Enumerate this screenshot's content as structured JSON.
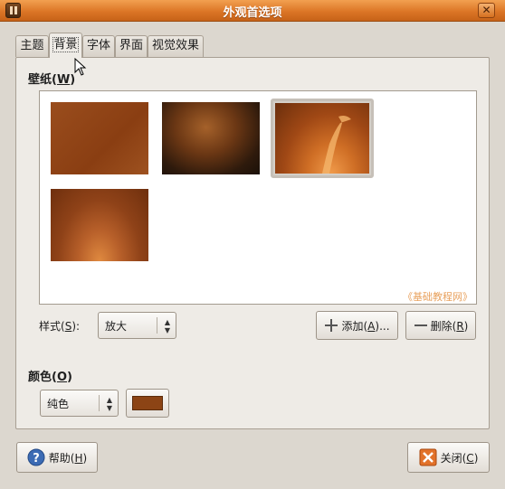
{
  "window": {
    "title": "外观首选项",
    "close_glyph": "✕"
  },
  "tabs": [
    {
      "label": "主题"
    },
    {
      "label": "背景",
      "active": true
    },
    {
      "label": "字体"
    },
    {
      "label": "界面"
    },
    {
      "label": "视觉效果"
    }
  ],
  "wallpaper": {
    "label_prefix": "壁纸(",
    "label_mnemonic": "W",
    "label_suffix": ")",
    "thumbnails": [
      {
        "name": "brown-solid",
        "selected": false
      },
      {
        "name": "dark-texture",
        "selected": false
      },
      {
        "name": "heron",
        "selected": true
      },
      {
        "name": "warm-rings",
        "selected": false
      }
    ],
    "watermark": "《基础教程网》"
  },
  "style": {
    "label_prefix": "样式(",
    "label_mnemonic": "S",
    "label_suffix": "):",
    "selected": "放大"
  },
  "buttons": {
    "add_prefix": "添加(",
    "add_mnemonic": "A",
    "add_suffix": ")...",
    "remove_prefix": "删除(",
    "remove_mnemonic": "R",
    "remove_suffix": ")"
  },
  "color": {
    "label_prefix": "颜色(",
    "label_mnemonic": "O",
    "label_suffix": ")",
    "mode": "纯色",
    "swatch": "#8c4415"
  },
  "footer": {
    "help_prefix": "帮助(",
    "help_mnemonic": "H",
    "help_suffix": ")",
    "close_prefix": "关闭(",
    "close_mnemonic": "C",
    "close_suffix": ")"
  },
  "icons": {
    "window": "app-icon",
    "help": "help-icon",
    "close": "close-icon",
    "add": "plus-icon",
    "remove": "minus-icon"
  }
}
